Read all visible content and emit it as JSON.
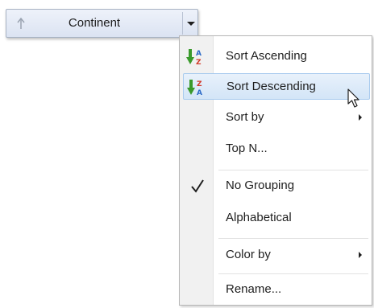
{
  "header": {
    "title": "Continent",
    "sort_icon": "arrow-up-icon",
    "dropdown_icon": "chevron-down-icon"
  },
  "menu": {
    "items": [
      {
        "label": "Sort Ascending",
        "icon": "sort-a-to-z-icon"
      },
      {
        "label": "Sort Descending",
        "icon": "sort-z-to-a-icon",
        "hovered": true
      },
      {
        "label": "Sort by",
        "submenu": true
      },
      {
        "label": "Top N..."
      },
      {
        "label": "No Grouping",
        "checked": true,
        "icon": "checkmark-icon"
      },
      {
        "label": "Alphabetical"
      },
      {
        "label": "Color by",
        "submenu": true
      },
      {
        "label": "Rename..."
      }
    ]
  },
  "colors": {
    "az_green": "#3a9a2c",
    "za_blue": "#2d6bc7",
    "hover_border": "#a9cbee"
  },
  "cursor": {
    "icon": "mouse-pointer-icon"
  }
}
